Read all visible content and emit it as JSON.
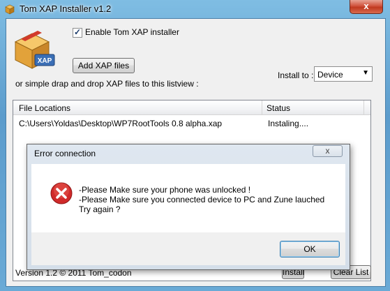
{
  "window": {
    "title": "Tom XAP Installer v1.2",
    "close_glyph": "x"
  },
  "options": {
    "enable_label": "Enable Tom XAP installer",
    "enable_checked": true,
    "check_glyph": "✓"
  },
  "toolbar": {
    "add_label": "Add XAP files",
    "hint": "or simple drap and drop XAP files to this  listview :",
    "install_to_label": "Install to :",
    "install_to_value": "Device",
    "dropdown_glyph": "▼"
  },
  "list": {
    "columns": [
      "File Locations",
      "Status"
    ],
    "rows": [
      [
        "C:\\Users\\Yoldas\\Desktop\\WP7RootTools 0.8 alpha.xap",
        "Instaling...."
      ]
    ]
  },
  "footer": {
    "version": "Version 1.2 © 2011 Tom_codon",
    "install_label": "Install",
    "clear_label": "Clear List"
  },
  "dialog": {
    "title": "Error connection",
    "close_glyph": "x",
    "lines": [
      "-Please Make sure your phone was unlocked !",
      "-Please Make sure you connected device to PC and Zune lauched",
      "Try again ?"
    ],
    "ok_label": "OK"
  },
  "colors": {
    "error_red": "#d02a2a",
    "logo_box": "#e2a23a",
    "logo_tag": "#3b6fb6"
  }
}
